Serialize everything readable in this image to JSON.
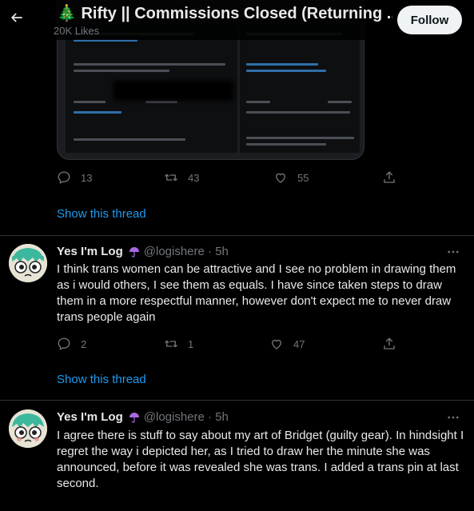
{
  "header": {
    "title": "🎄 Rifty || Commissions Closed (Returning ...",
    "subtitle": "20K Likes",
    "follow_label": "Follow"
  },
  "tweet1": {
    "replies": "13",
    "retweets": "43",
    "likes": "55",
    "show_thread": "Show this thread"
  },
  "tweet2": {
    "name": "Yes I'm Log",
    "handle": "@logishere · 5h",
    "text": "I think trans women can be attractive and I see no problem in drawing them as i would others, I see them as equals. I have since taken steps to draw them in a more respectful manner, however don't expect me to never draw trans people again",
    "replies": "2",
    "retweets": "1",
    "likes": "47",
    "show_thread": "Show this thread"
  },
  "tweet3": {
    "name": "Yes I'm Log",
    "handle": "@logishere · 5h",
    "text": "I agree there is stuff to say about my art of Bridget (guilty gear). In hindsight I regret the way i depicted her, as I tried to draw her the minute she was announced, before it was revealed she was trans. I added a trans pin at last second."
  },
  "colors": {
    "accent": "#1d9bf0",
    "background": "#000000",
    "muted": "#71767b",
    "divider": "#2f3336"
  },
  "icons": [
    "back-arrow-icon",
    "reply-icon",
    "retweet-icon",
    "like-icon",
    "share-icon",
    "more-icon",
    "umbrella-icon"
  ]
}
